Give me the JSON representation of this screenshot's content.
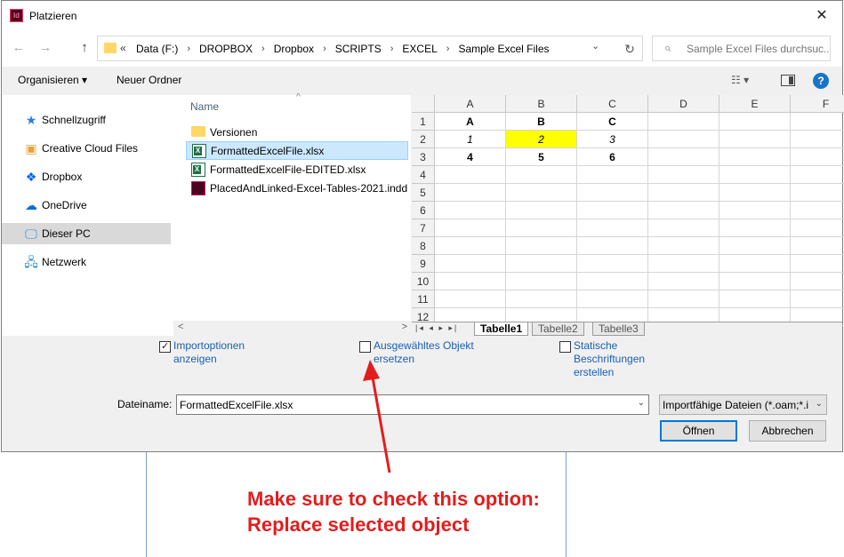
{
  "window": {
    "app_icon_text": "Id",
    "title": "Platzieren",
    "close": "✕"
  },
  "nav": {
    "back": "←",
    "forward": "→",
    "up": "↑"
  },
  "address": {
    "prefix": "«",
    "crumbs": [
      "Data (F:)",
      "DROPBOX",
      "Dropbox",
      "SCRIPTS",
      "EXCEL",
      "Sample Excel Files"
    ],
    "separator": "›",
    "dropdown": "⌄",
    "refresh": "↻"
  },
  "search": {
    "placeholder": "Sample Excel Files durchsuc...",
    "icon": "⌕"
  },
  "toolbar": {
    "organize": "Organisieren ▾",
    "new_folder": "Neuer Ordner",
    "view": "☷ ▾",
    "help": "?"
  },
  "sidebar": {
    "items": [
      {
        "label": "Schnellzugriff",
        "icon": "star-icon",
        "glyph": "★",
        "color": "#2b7fd8"
      },
      {
        "label": "Creative Cloud Files",
        "icon": "creative-cloud-icon",
        "glyph": "▣",
        "color": "#e8a33a"
      },
      {
        "label": "Dropbox",
        "icon": "dropbox-icon",
        "glyph": "❖",
        "color": "#0061fe"
      },
      {
        "label": "OneDrive",
        "icon": "onedrive-icon",
        "glyph": "☁",
        "color": "#0a6cd6"
      },
      {
        "label": "Dieser PC",
        "icon": "computer-icon",
        "glyph": "🖵",
        "color": "#2a8ad6",
        "selected": true
      },
      {
        "label": "Netzwerk",
        "icon": "network-icon",
        "glyph": "🖧",
        "color": "#2a8ad6"
      }
    ]
  },
  "files": {
    "column_name": "Name",
    "sort_arrow": "^",
    "items": [
      {
        "label": "Versionen",
        "icon": "folder-icon",
        "selected": false
      },
      {
        "label": "FormattedExcelFile.xlsx",
        "icon": "excel-file-icon",
        "selected": true
      },
      {
        "label": "FormattedExcelFile-EDITED.xlsx",
        "icon": "excel-file-icon",
        "selected": false
      },
      {
        "label": "PlacedAndLinked-Excel-Tables-2021.indd",
        "icon": "indesign-file-icon",
        "selected": false
      }
    ],
    "scroll_left": "<",
    "scroll_right": ">"
  },
  "preview": {
    "columns": [
      "A",
      "B",
      "C",
      "D",
      "E",
      "F"
    ],
    "rows": [
      "1",
      "2",
      "3",
      "4",
      "5",
      "6",
      "7",
      "8",
      "9",
      "10",
      "11",
      "12"
    ],
    "cells": [
      [
        "A",
        "B",
        "C"
      ],
      [
        "1",
        "2",
        "3"
      ],
      [
        "4",
        "5",
        "6"
      ]
    ],
    "highlight_color": "#ffff00",
    "tab_nav": "|◂ ◂ ▸ ▸|",
    "sheets": [
      "Tabelle1",
      "Tabelle2",
      "Tabelle3"
    ]
  },
  "options": {
    "import_options": "Importoptionen anzeigen",
    "import_options_checked": true,
    "replace_selected": "Ausgewähltes Objekt ersetzen",
    "replace_selected_checked": false,
    "static_captions": "Statische Beschriftungen erstellen",
    "static_captions_checked": false
  },
  "filename": {
    "label": "Dateiname:",
    "value": "FormattedExcelFile.xlsx",
    "dropdown": "⌄",
    "filter": "Importfähige Dateien (*.oam;*.i",
    "filter_dropdown": "⌄"
  },
  "buttons": {
    "open": "Öffnen",
    "cancel": "Abbrechen"
  },
  "annotation": {
    "line1": "Make sure to check this option:",
    "line2": "Replace selected object",
    "color": "#e21d1d"
  }
}
